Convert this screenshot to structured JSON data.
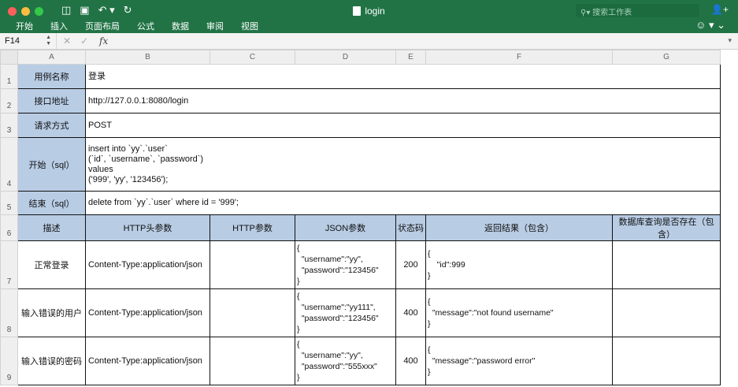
{
  "window": {
    "title": "login",
    "search_placeholder": "搜索工作表",
    "menu": [
      "开始",
      "插入",
      "页面布局",
      "公式",
      "数据",
      "审阅",
      "视图"
    ]
  },
  "formula_bar": {
    "cell_ref": "F14",
    "fx": "fx",
    "value": ""
  },
  "columns": [
    "A",
    "B",
    "C",
    "D",
    "E",
    "F",
    "G"
  ],
  "rows": [
    "1",
    "2",
    "3",
    "4",
    "5",
    "6",
    "7",
    "8",
    "9"
  ],
  "info": [
    {
      "label": "用例名称",
      "value": "登录"
    },
    {
      "label": "接口地址",
      "value": "http://127.0.0.1:8080/login"
    },
    {
      "label": "请求方式",
      "value": "POST"
    },
    {
      "label": "开始（sql）",
      "value": "insert into `yy`.`user`\n(`id`, `username`, `password`)\nvalues\n('999', 'yy', '123456');"
    },
    {
      "label": "结束（sql）",
      "value": "delete from `yy`.`user` where id = '999';"
    }
  ],
  "headers": [
    "描述",
    "HTTP头参数",
    "HTTP参数",
    "JSON参数",
    "状态码",
    "返回结果（包含）",
    "数据库查询是否存在（包含）"
  ],
  "cases": [
    {
      "desc": "正常登录",
      "http_header": "Content-Type:application/json",
      "http_param": "",
      "json": "{\n  \"username\":\"yy\",\n  \"password\":\"123456\"\n}",
      "status": "200",
      "result": "{\n    \"id\":999\n}",
      "db": ""
    },
    {
      "desc": "输入错误的用户",
      "http_header": "Content-Type:application/json",
      "http_param": "",
      "json": "{\n  \"username\":\"yy111\",\n  \"password\":\"123456\"\n}",
      "status": "400",
      "result": "{\n  \"message\":\"not found username\"\n}",
      "db": ""
    },
    {
      "desc": "输入错误的密码",
      "http_header": "Content-Type:application/json",
      "http_param": "",
      "json": "{\n  \"username\":\"yy\",\n  \"password\":\"555xxx\"\n}",
      "status": "400",
      "result": "{\n  \"message\":\"password error\"\n}",
      "db": ""
    }
  ],
  "colors": {
    "ribbon": "#217346",
    "label_fill": "#b8cce4"
  }
}
